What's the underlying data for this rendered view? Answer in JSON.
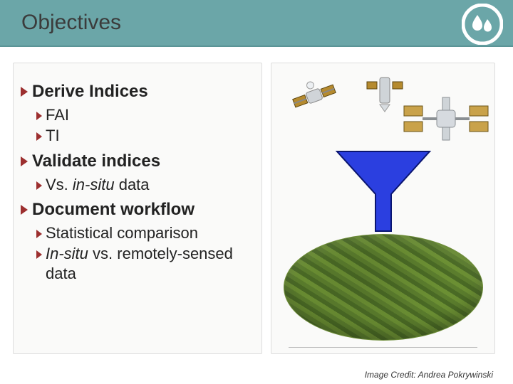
{
  "header": {
    "title": "Objectives"
  },
  "bullets": {
    "b1": {
      "label": "Derive Indices"
    },
    "b1a": {
      "label": "FAI"
    },
    "b1b": {
      "label": "TI"
    },
    "b2": {
      "label": "Validate indices"
    },
    "b2a_pre": "Vs. ",
    "b2a_em": "in-situ",
    "b2a_post": " data",
    "b3": {
      "label": "Document workflow"
    },
    "b3a": {
      "label": "Statistical comparison"
    },
    "b3b_em": "In-situ",
    "b3b_post": " vs. remotely-sensed data"
  },
  "credit": {
    "text": "Image Credit: Andrea Pokrywinski"
  },
  "icons": {
    "logo": "water-drops-logo",
    "satellite": "satellite-icon",
    "space_station": "space-station-icon",
    "arrow": "down-arrow-icon",
    "algae": "algae-ellipse"
  },
  "colors": {
    "header_bg": "#6ba6a8",
    "bullet_arrow": "#9c2f2f",
    "flow_arrow": "#1a2fcf"
  }
}
